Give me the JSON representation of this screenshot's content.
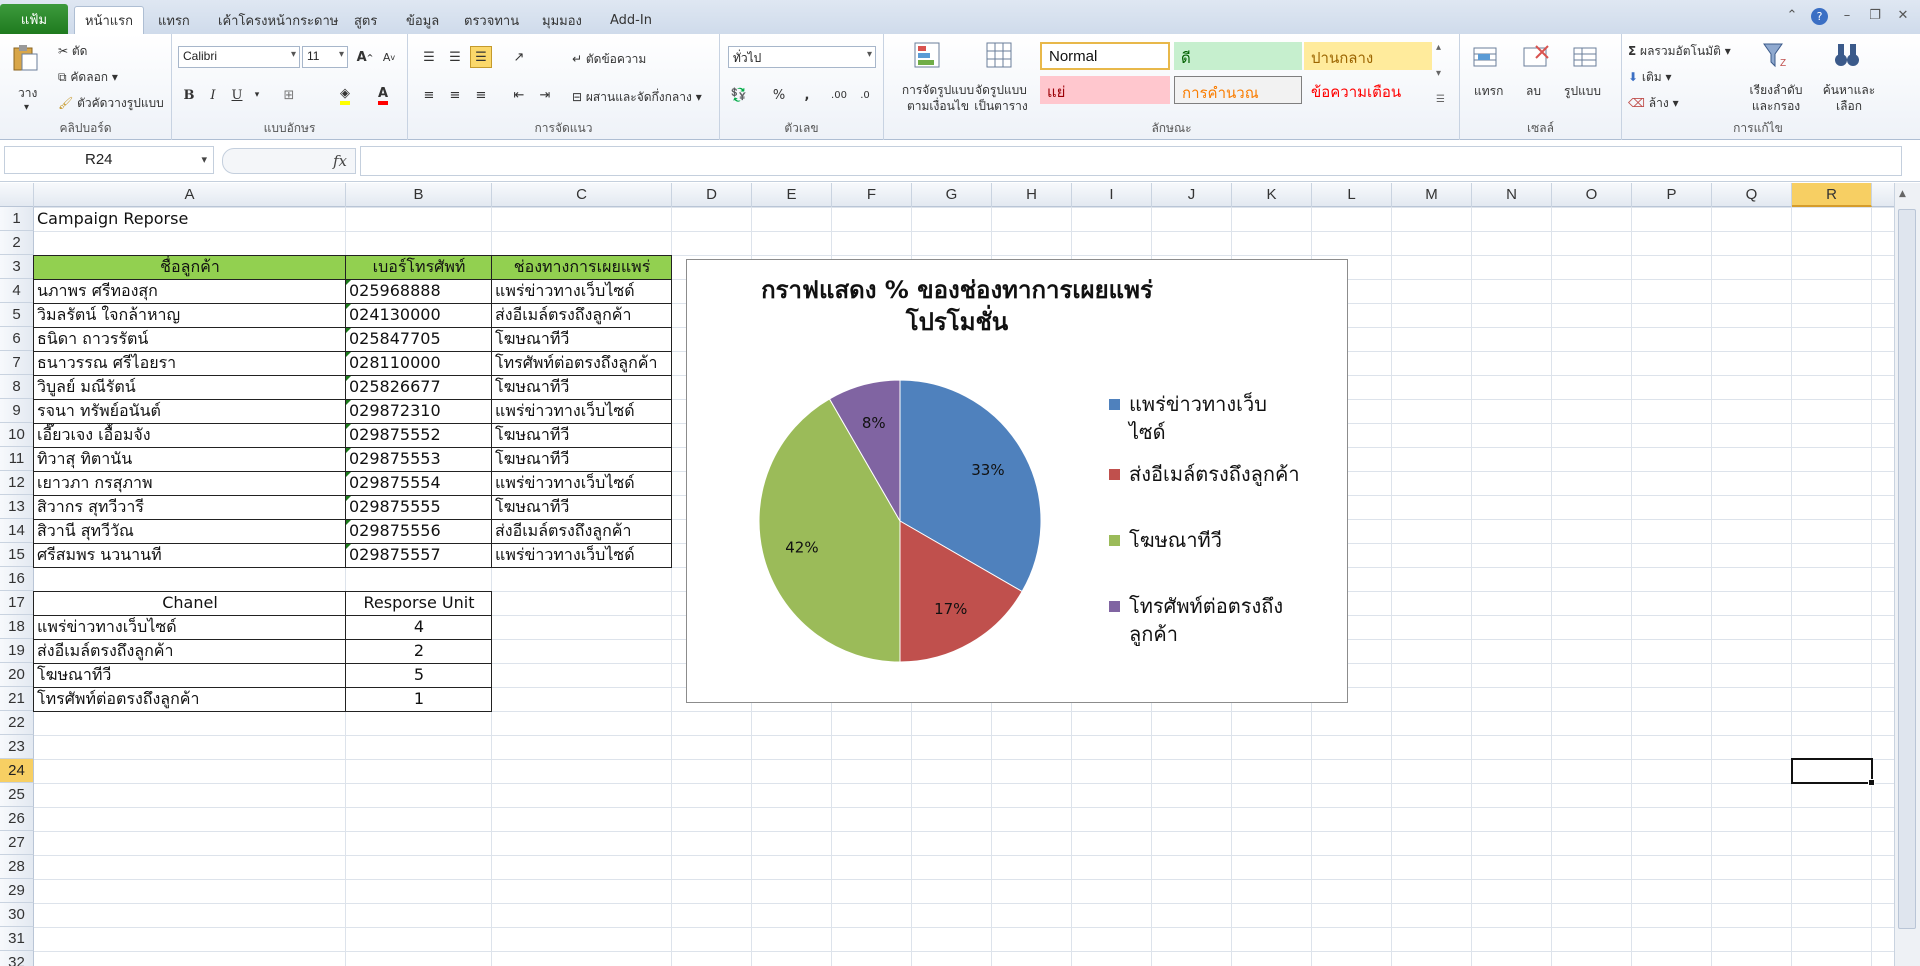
{
  "tabs": {
    "file": "แฟ้ม",
    "items": [
      "หน้าแรก",
      "แทรก",
      "เค้าโครงหน้ากระดาษ",
      "สูตร",
      "ข้อมูล",
      "ตรวจทาน",
      "มุมมอง",
      "Add-In"
    ]
  },
  "ribbon": {
    "clipboard": {
      "paste": "วาง",
      "cut": "ตัด",
      "copy": "คัดลอก",
      "format_painter": "ตัวคัดวางรูปแบบ",
      "title": "คลิปบอร์ด"
    },
    "font": {
      "name": "Calibri",
      "size": "11",
      "title": "แบบอักษร"
    },
    "alignment": {
      "wrap": "ตัดข้อความ",
      "merge": "ผสานและจัดกึ่งกลาง",
      "title": "การจัดแนว"
    },
    "number": {
      "format": "ทั่วไป",
      "title": "ตัวเลข"
    },
    "styles": {
      "cond_format": "การจัดรูปแบบตามเงื่อนไข",
      "format_table": "จัดรูปแบบเป็นตาราง",
      "normal": "Normal",
      "good": "ดี",
      "neutral": "ปานกลาง",
      "bad": "แย่",
      "calc": "การคำนวณ",
      "warning": "ข้อความเตือน",
      "title": "ลักษณะ"
    },
    "cells": {
      "insert": "แทรก",
      "delete": "ลบ",
      "format": "รูปแบบ",
      "title": "เซลล์"
    },
    "editing": {
      "autosum": "ผลรวมอัตโนมัติ",
      "fill": "เติม",
      "clear": "ล้าง",
      "sort": "เรียงลำดับและกรอง",
      "find": "ค้นหาและเลือก",
      "title": "การแก้ไข"
    },
    "colors": {
      "good_bg": "#c6efce",
      "good_fg": "#006100",
      "neutral_bg": "#ffeb9c",
      "neutral_fg": "#9c6500",
      "bad_bg": "#ffc7ce",
      "bad_fg": "#9c0006",
      "calc_fg": "#fa7d00",
      "warning_fg": "#ff0000"
    }
  },
  "formula_bar": {
    "name_box": "R24",
    "fx": "fx",
    "content": ""
  },
  "grid": {
    "columns": [
      "A",
      "B",
      "C",
      "D",
      "E",
      "F",
      "G",
      "H",
      "I",
      "J",
      "K",
      "L",
      "M",
      "N",
      "O",
      "P",
      "Q",
      "R"
    ],
    "rows": [
      "1",
      "2",
      "3",
      "4",
      "5",
      "6",
      "7",
      "8",
      "9",
      "10",
      "11",
      "12",
      "13",
      "14",
      "15",
      "16",
      "17",
      "18",
      "19",
      "20",
      "21",
      "22",
      "23",
      "24",
      "25",
      "26",
      "27",
      "28",
      "29",
      "30",
      "31",
      "32"
    ],
    "selected_col": "R",
    "selected_row": "24"
  },
  "sheet": {
    "title": "Campaign Reporse",
    "headers": [
      "ชื่อลูกค้า",
      "เบอร์โทรศัพท์",
      "ช่องทางการเผยแพร่"
    ],
    "header_color": "#92d050",
    "rows": [
      [
        "นภาพร ศรีทองสุก",
        "025968888",
        "แพร่ข่าวทางเว็บไซด์"
      ],
      [
        "วิมลรัตน์ ใจกล้าหาญ",
        "024130000",
        "ส่งอีเมล์ตรงถึงลูกค้า"
      ],
      [
        "ธนิดา ถาวรรัตน์",
        "025847705",
        "โฆษณาทีวี"
      ],
      [
        "ธนาวรรณ ศรีไอยรา",
        "028110000",
        "โทรศัพท์ต่อตรงถึงลูกค้า"
      ],
      [
        "วิบูลย์ มณีรัตน์",
        "025826677",
        "โฆษณาทีวี"
      ],
      [
        "รจนา ทรัพย์อนันต์",
        "029872310",
        "แพร่ข่าวทางเว็บไซด์"
      ],
      [
        "เอี๊ยวเจง เอื้อมจัง",
        "029875552",
        "โฆษณาทีวี"
      ],
      [
        "ทิวาสุ ทิตานัน",
        "029875553",
        "โฆษณาทีวี"
      ],
      [
        "เยาวภา กรสุภาพ",
        "029875554",
        "แพร่ข่าวทางเว็บไซด์"
      ],
      [
        "สิวากร สุทวีวารี",
        "029875555",
        "โฆษณาทีวี"
      ],
      [
        "สิวานี สุทวีวัณ",
        "029875556",
        "ส่งอีเมล์ตรงถึงลูกค้า"
      ],
      [
        "ศรีสมพร นวนานที",
        "029875557",
        "แพร่ข่าวทางเว็บไซด์"
      ]
    ],
    "summary_headers": [
      "Chanel",
      "Resporse Unit"
    ],
    "summary_rows": [
      [
        "แพร่ข่าวทางเว็บไซด์",
        "4"
      ],
      [
        "ส่งอีเมล์ตรงถึงลูกค้า",
        "2"
      ],
      [
        "โฆษณาทีวี",
        "5"
      ],
      [
        "โทรศัพท์ต่อตรงถึงลูกค้า",
        "1"
      ]
    ]
  },
  "chart_data": {
    "type": "pie",
    "title": "กราฟแสดง % ของช่องทาการเผยแพร่โปรโมชั่น",
    "title_lines": [
      "กราฟแสดง % ของช่องทาการเผยแพร่",
      "โปรโมชั่น"
    ],
    "categories": [
      "แพร่ข่าวทางเว็บไซด์",
      "ส่งอีเมล์ตรงถึงลูกค้า",
      "โฆษณาทีวี",
      "โทรศัพท์ต่อตรงถึงลูกค้า"
    ],
    "legend_lines": [
      [
        "แพร่ข่าวทางเว็บ",
        "ไซด์"
      ],
      [
        "ส่งอีเมล์ตรงถึงลูกค้า"
      ],
      [
        "โฆษณาทีวี"
      ],
      [
        "โทรศัพท์ต่อตรงถึง",
        "ลูกค้า"
      ]
    ],
    "values": [
      4,
      2,
      5,
      1
    ],
    "labels": [
      "33%",
      "17%",
      "42%",
      "8%"
    ],
    "colors": [
      "#4f81bd",
      "#c0504d",
      "#9bbb59",
      "#8064a2"
    ],
    "legend": "right"
  }
}
